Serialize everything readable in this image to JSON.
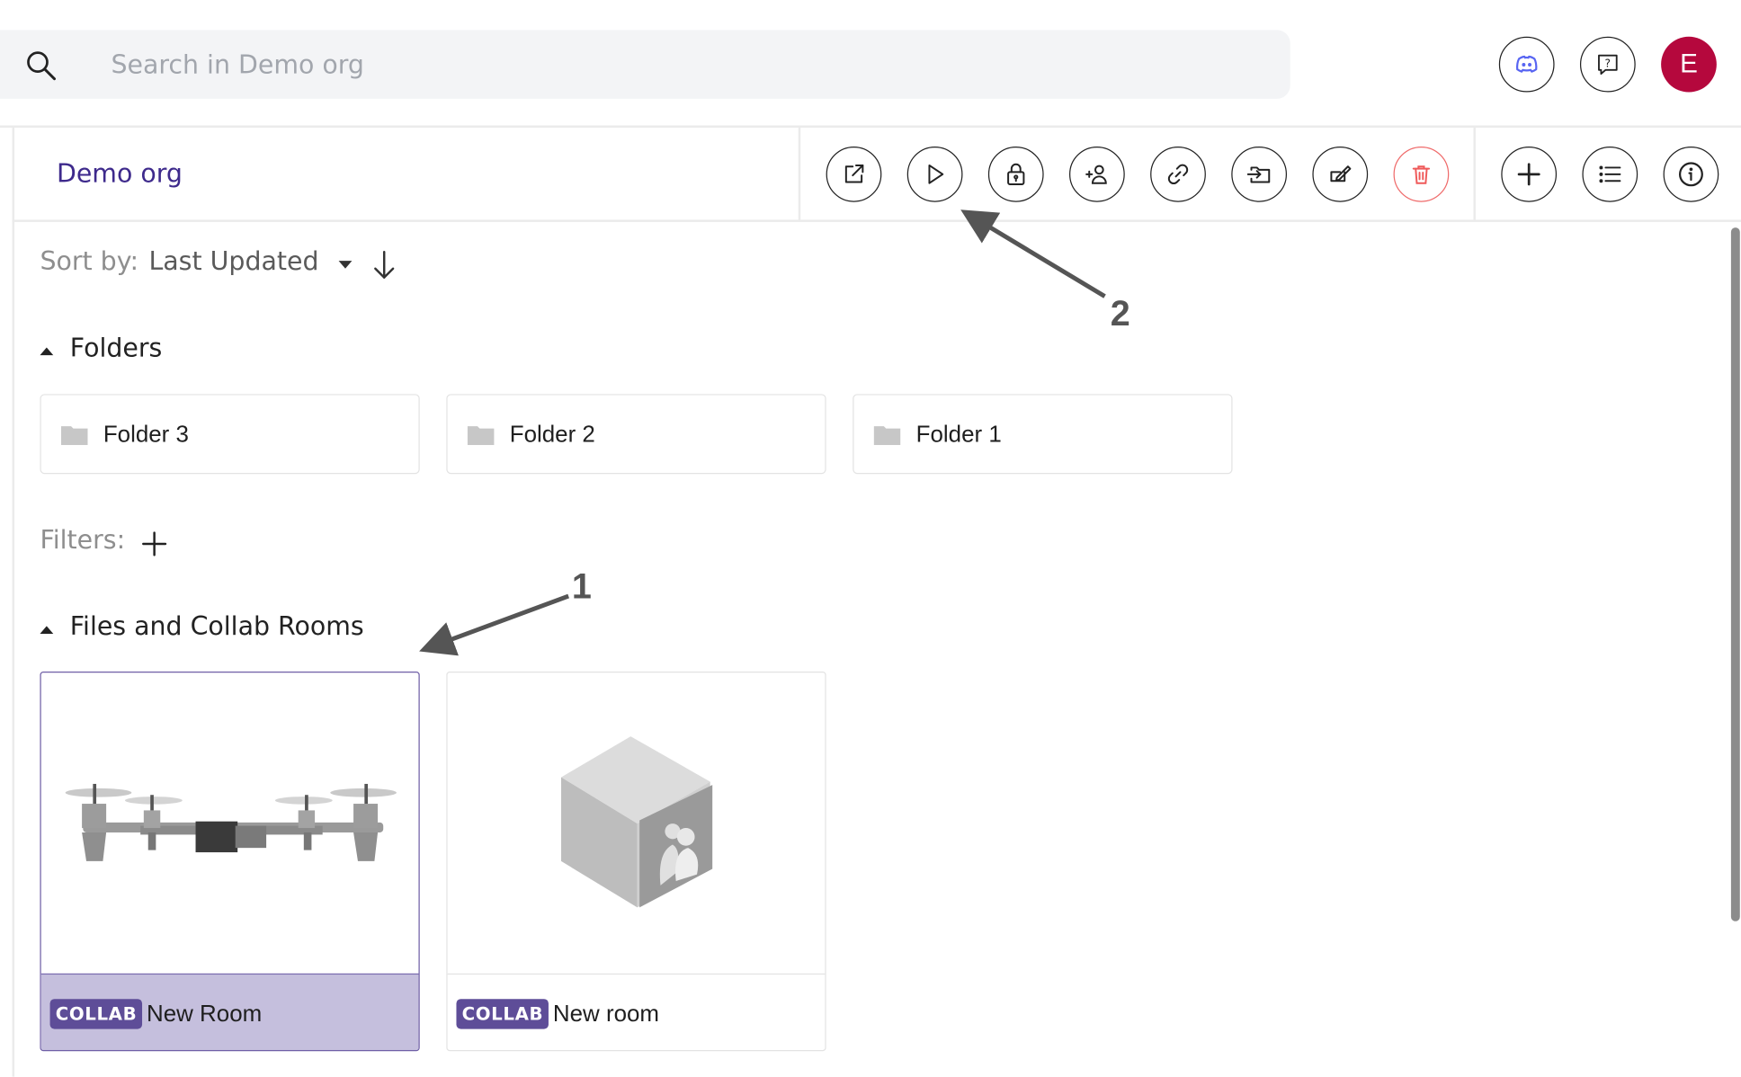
{
  "search": {
    "placeholder": "Search in Demo org"
  },
  "header": {
    "avatar_letter": "E"
  },
  "breadcrumb": {
    "title": "Demo org"
  },
  "sort": {
    "label": "Sort by:",
    "value": "Last Updated"
  },
  "folders_section": {
    "title": "Folders"
  },
  "folders": [
    {
      "name": "Folder 3"
    },
    {
      "name": "Folder 2"
    },
    {
      "name": "Folder 1"
    }
  ],
  "filters": {
    "label": "Filters:"
  },
  "files_section": {
    "title": "Files and Collab Rooms"
  },
  "files": [
    {
      "badge": "COLLAB",
      "name": "New Room",
      "thumbnail": "drone-model"
    },
    {
      "badge": "COLLAB",
      "name": "New room",
      "thumbnail": "collab-cube"
    }
  ],
  "annotations": {
    "one": "1",
    "two": "2"
  },
  "colors": {
    "accent": "#5e4d98",
    "avatar": "#b5083d",
    "selected_footer": "#c5bfdd",
    "link": "#3e2a8c",
    "danger": "#ef6b6b"
  },
  "icons": {
    "toolbar": [
      "open-external-icon",
      "play-icon",
      "lock-icon",
      "add-user-icon",
      "link-icon",
      "move-to-folder-icon",
      "sign-icon",
      "trash-icon"
    ],
    "toolbar_right": [
      "plus-icon",
      "list-view-icon",
      "info-icon"
    ],
    "header": [
      "discord-icon",
      "help-icon"
    ]
  }
}
